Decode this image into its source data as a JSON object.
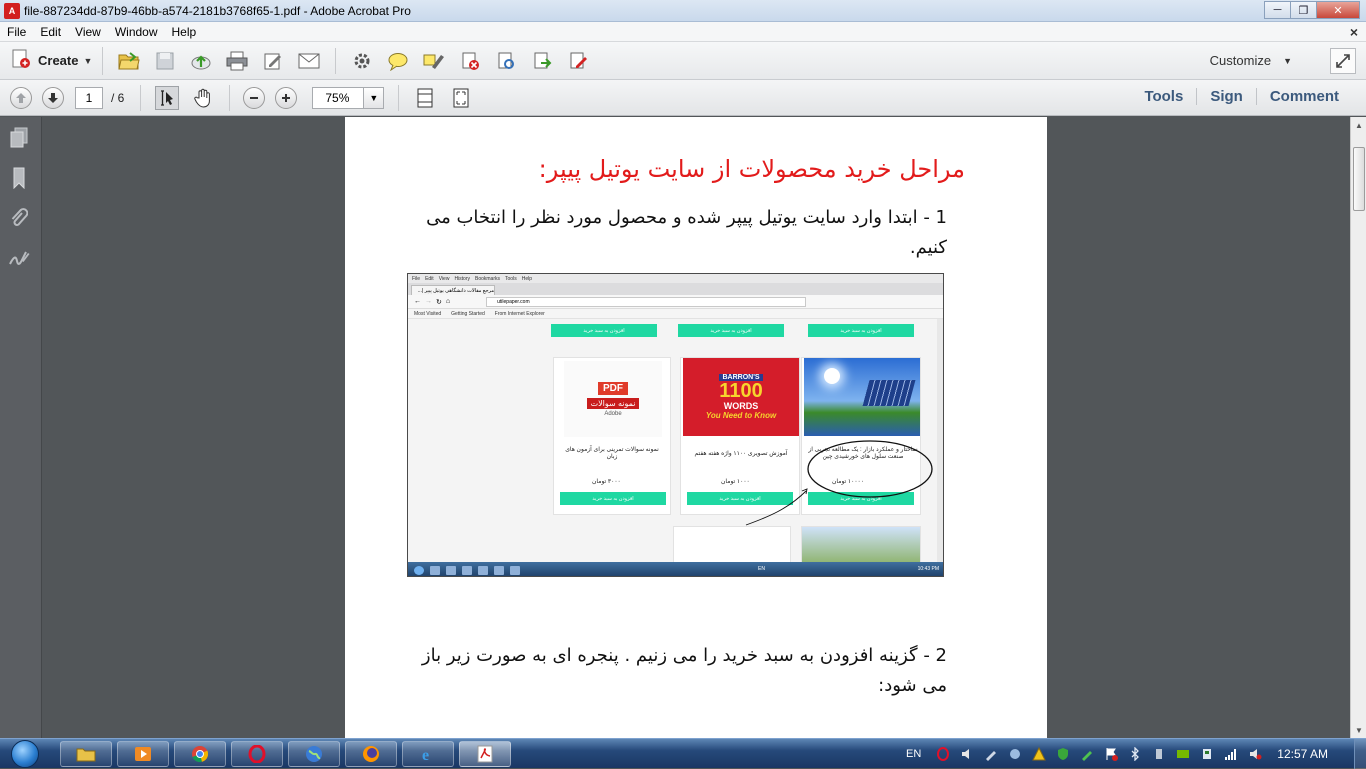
{
  "window": {
    "title": "file-887234dd-87b9-46bb-a574-2181b3768f65-1.pdf - Adobe Acrobat Pro",
    "minimize": "─",
    "maximize": "❐",
    "close": "✕"
  },
  "menu": {
    "items": [
      "File",
      "Edit",
      "View",
      "Window",
      "Help"
    ],
    "close_doc": "×"
  },
  "toolbar": {
    "create_label": "Create",
    "customize_label": "Customize",
    "icons": [
      "open-icon",
      "save-icon",
      "upload-icon",
      "print-icon",
      "edit-icon",
      "email-icon",
      "settings-icon",
      "comment-icon",
      "highlight-icon",
      "delete-icon",
      "scan-icon",
      "export-icon",
      "sign-icon"
    ]
  },
  "navbar": {
    "current_page": "1",
    "total_pages": "/ 6",
    "zoom": "75%",
    "tools": "Tools",
    "sign": "Sign",
    "comment": "Comment"
  },
  "document": {
    "heading": "مراحل خرید محصولات از سایت یوتیل پیپر:",
    "step1": "1 - ابتدا وارد سایت یوتیل پیپر شده و محصول مورد نظر را انتخاب می کنیم.",
    "step2": "2 - گزینه افزودن به سبد خرید را می زنیم . پنجره ای به صورت زیر باز می شود:",
    "screenshot": {
      "browser_menu": [
        "File",
        "Edit",
        "View",
        "History",
        "Bookmarks",
        "Tools",
        "Help"
      ],
      "tab_title": "مرجع مقالات دانشگاهی یوتیل پیپر |...",
      "url": "utilepaper.com",
      "bookmarks": [
        "Most Visited",
        "Getting Started",
        "From Internet Explorer"
      ],
      "add_to_cart": "افزودن به سبد خرید",
      "products": [
        {
          "title": "نمونه سوالات تمرینی برای آزمون های زبان",
          "price": "۳۰۰۰ تومان",
          "image_text": "PDF نمونه سوالات Adobe"
        },
        {
          "title": "آموزش تصویری ۱۱۰۰ واژه هفته هفتم",
          "price": "۱۰۰۰ تومان",
          "image_text": "BARRON'S 1100 WORDS You Need to Know"
        },
        {
          "title": "ساختار و عملکرد بازار : یک مطالعه تجربی از صنعت سلول های خورشیدی چین",
          "price": "۱۰۰۰۰ تومان",
          "image_text": ""
        }
      ],
      "taskbar_lang": "EN",
      "taskbar_time": "10:43 PM"
    }
  },
  "taskbar": {
    "apps": [
      "explorer-icon",
      "media-player-icon",
      "chrome-icon",
      "opera-icon",
      "globe-icon",
      "firefox-icon",
      "ie-icon",
      "acrobat-icon"
    ],
    "lang": "EN",
    "time": "12:57 AM"
  }
}
